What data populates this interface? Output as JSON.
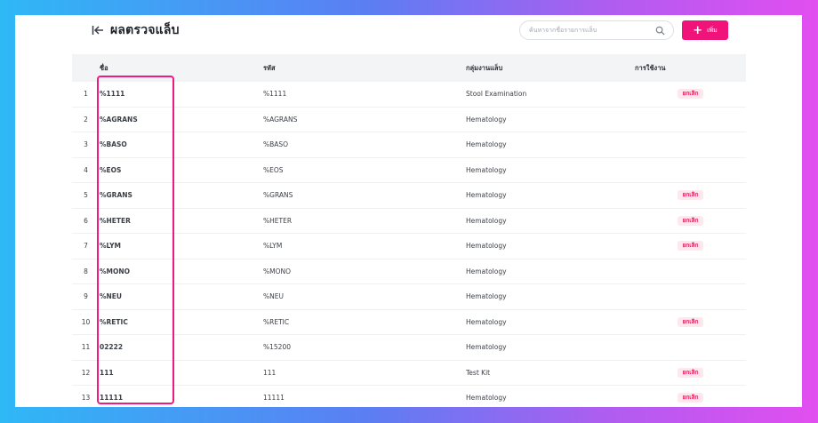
{
  "header": {
    "title": "ผลตรวจแล็บ",
    "back_icon": "arrow-left-to-line-icon",
    "search_placeholder": "ค้นหาจากชื่อรายการแล็บ",
    "search_icon": "search-icon",
    "add_label": "เพิ่ม",
    "add_icon": "plus-icon"
  },
  "colors": {
    "accent": "#f0137a",
    "badge_bg": "#fde8ee",
    "badge_text": "#e0245e",
    "header_row_bg": "#f3f4f6"
  },
  "table": {
    "columns": [
      "ชื่อ",
      "รหัส",
      "กลุ่มงานแล็บ",
      "การใช้งาน"
    ],
    "rows": [
      {
        "num": "1",
        "name": "%1111",
        "code": "%1111",
        "group": "Stool Examination",
        "status": "ยกเลิก"
      },
      {
        "num": "2",
        "name": "%AGRANS",
        "code": "%AGRANS",
        "group": "Hematology",
        "status": ""
      },
      {
        "num": "3",
        "name": "%BASO",
        "code": "%BASO",
        "group": "Hematology",
        "status": ""
      },
      {
        "num": "4",
        "name": "%EOS",
        "code": "%EOS",
        "group": "Hematology",
        "status": ""
      },
      {
        "num": "5",
        "name": "%GRANS",
        "code": "%GRANS",
        "group": "Hematology",
        "status": "ยกเลิก"
      },
      {
        "num": "6",
        "name": "%HETER",
        "code": "%HETER",
        "group": "Hematology",
        "status": "ยกเลิก"
      },
      {
        "num": "7",
        "name": "%LYM",
        "code": "%LYM",
        "group": "Hematology",
        "status": "ยกเลิก"
      },
      {
        "num": "8",
        "name": "%MONO",
        "code": "%MONO",
        "group": "Hematology",
        "status": ""
      },
      {
        "num": "9",
        "name": "%NEU",
        "code": "%NEU",
        "group": "Hematology",
        "status": ""
      },
      {
        "num": "10",
        "name": "%RETIC",
        "code": "%RETIC",
        "group": "Hematology",
        "status": "ยกเลิก"
      },
      {
        "num": "11",
        "name": "02222",
        "code": "%15200",
        "group": "Hematology",
        "status": ""
      },
      {
        "num": "12",
        "name": "111",
        "code": "111",
        "group": "Test Kit",
        "status": "ยกเลิก"
      },
      {
        "num": "13",
        "name": "11111",
        "code": "11111",
        "group": "Hematology",
        "status": "ยกเลิก"
      }
    ]
  }
}
